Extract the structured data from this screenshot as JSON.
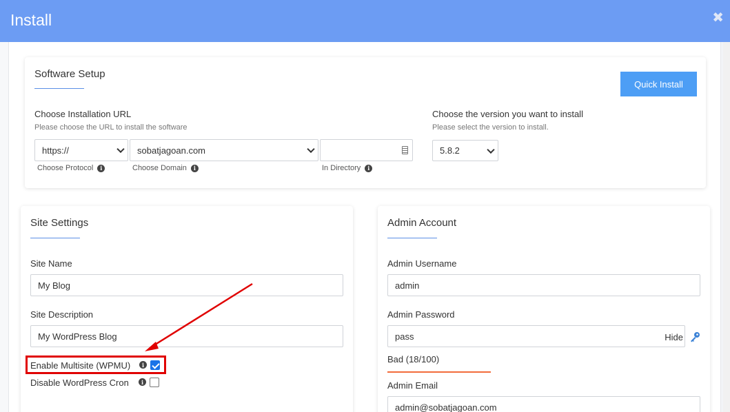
{
  "modal": {
    "title": "Install",
    "close_symbol": "✖"
  },
  "software_setup": {
    "title": "Software Setup",
    "quick_install_label": "Quick Install",
    "install_url": {
      "label": "Choose Installation URL",
      "help": "Please choose the URL to install the software",
      "protocol_value": "https://",
      "protocol_hint": "Choose Protocol",
      "domain_value": "sobatjagoan.com",
      "domain_hint": "Choose Domain",
      "directory_value": "",
      "directory_hint": "In Directory"
    },
    "version": {
      "label": "Choose the version you want to install",
      "help": "Please select the version to install.",
      "value": "5.8.2"
    }
  },
  "site_settings": {
    "title": "Site Settings",
    "site_name_label": "Site Name",
    "site_name_value": "My Blog",
    "site_description_label": "Site Description",
    "site_description_value": "My WordPress Blog",
    "multisite_label": "Enable Multisite (WPMU)",
    "multisite_checked": true,
    "cron_label": "Disable WordPress Cron",
    "cron_checked": false
  },
  "admin_account": {
    "title": "Admin Account",
    "username_label": "Admin Username",
    "username_value": "admin",
    "password_label": "Admin Password",
    "password_value": "pass",
    "hide_label": "Hide",
    "strength_text": "Bad (18/100)",
    "email_label": "Admin Email",
    "email_value": "admin@sobatjagoan.com"
  },
  "colors": {
    "header": "#6c9cf3",
    "accent": "#4d9ef5",
    "highlight": "#e00000",
    "strength_bad": "#f26b3a"
  }
}
